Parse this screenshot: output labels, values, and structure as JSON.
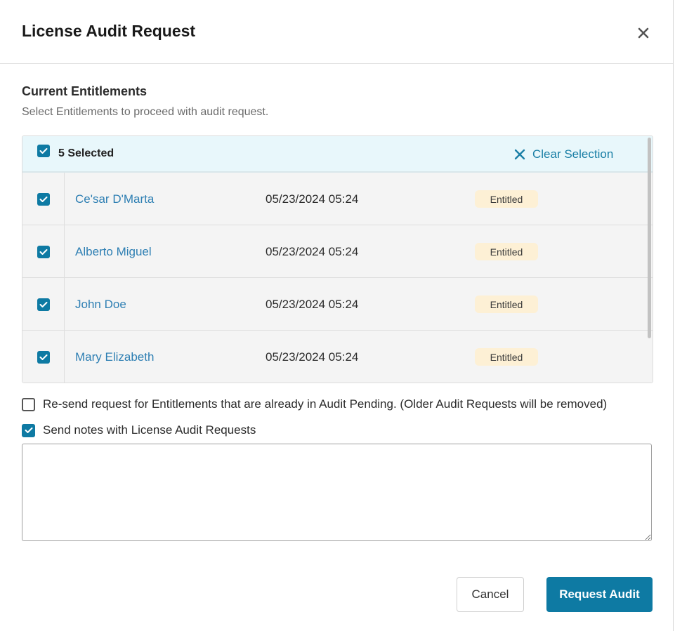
{
  "dialog": {
    "title": "License Audit Request",
    "close_icon": "close-icon"
  },
  "section": {
    "title": "Current Entitlements",
    "subtitle": "Select Entitlements to proceed with audit request."
  },
  "table": {
    "selected_label": "5 Selected",
    "clear_selection_label": "Clear Selection",
    "rows": [
      {
        "name": "Ce'sar D'Marta",
        "date": "05/23/2024 05:24",
        "status": "Entitled",
        "checked": true
      },
      {
        "name": "Alberto Miguel",
        "date": "05/23/2024 05:24",
        "status": "Entitled",
        "checked": true
      },
      {
        "name": "John Doe",
        "date": "05/23/2024 05:24",
        "status": "Entitled",
        "checked": true
      },
      {
        "name": "Mary Elizabeth",
        "date": "05/23/2024 05:24",
        "status": "Entitled",
        "checked": true
      }
    ]
  },
  "options": {
    "resend_label": "Re-send request for Entitlements that are already in Audit Pending. (Older Audit Requests will be removed)",
    "resend_checked": false,
    "notes_label": "Send notes with License Audit Requests",
    "notes_checked": true,
    "notes_value": ""
  },
  "footer": {
    "cancel_label": "Cancel",
    "request_label": "Request Audit"
  },
  "colors": {
    "accent": "#0e7aa3",
    "link": "#2e7fb3",
    "header_bg": "#e8f7fb",
    "badge_bg": "#fdf0d5"
  }
}
